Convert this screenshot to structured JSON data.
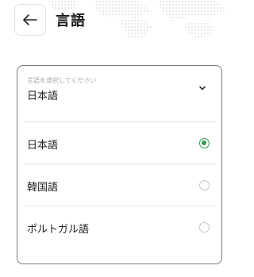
{
  "header": {
    "back_icon": "arrow-left-icon",
    "title": "言語"
  },
  "select": {
    "hint": "言語を選択してください",
    "value": "日本語",
    "chevron_icon": "chevron-down-icon"
  },
  "options": [
    {
      "label": "日本語",
      "selected": true
    },
    {
      "label": "韓国語",
      "selected": false
    },
    {
      "label": "ポルトガル語",
      "selected": false
    }
  ],
  "colors": {
    "accent": "#2f9e4a",
    "border": "#7a7a7a",
    "divider": "#e4e4e4"
  }
}
